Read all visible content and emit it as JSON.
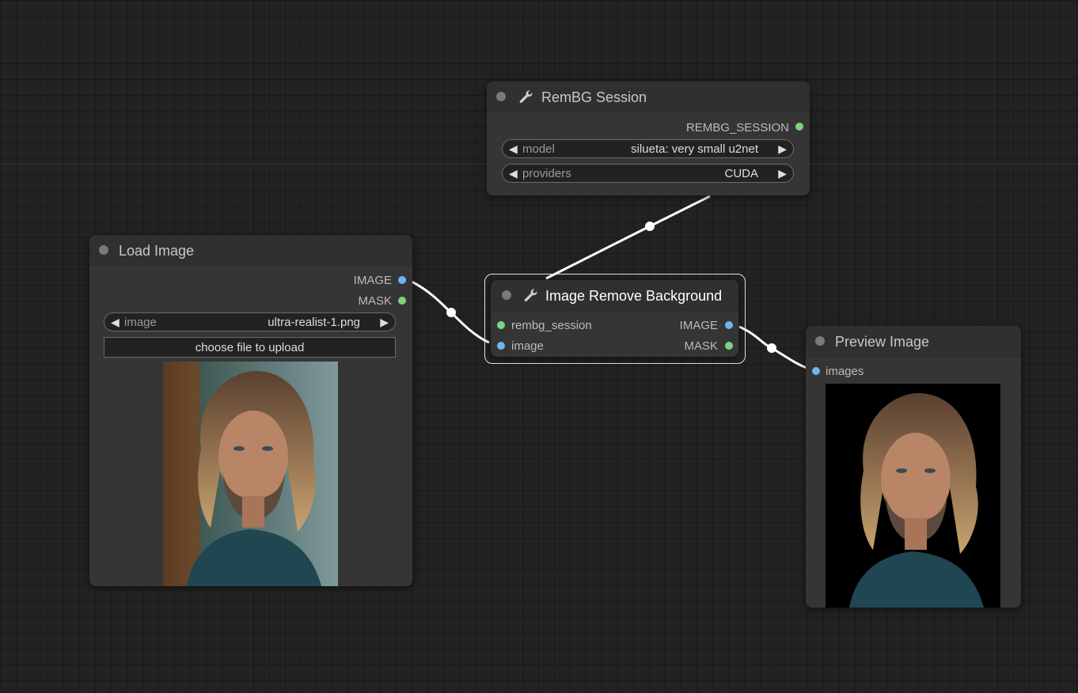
{
  "nodes": {
    "rembg_session": {
      "title": "RemBG Session",
      "outputs": [
        "REMBG_SESSION"
      ],
      "widgets": [
        {
          "name": "model",
          "value": "silueta: very small u2net"
        },
        {
          "name": "providers",
          "value": "CUDA"
        }
      ]
    },
    "load_image": {
      "title": "Load Image",
      "outputs": [
        "IMAGE",
        "MASK"
      ],
      "widgets": [
        {
          "name": "image",
          "value": "ultra-realist-1.png"
        }
      ],
      "upload_label": "choose file to upload"
    },
    "image_remove_background": {
      "title": "Image Remove Background",
      "inputs": [
        "rembg_session",
        "image"
      ],
      "outputs": [
        "IMAGE",
        "MASK"
      ]
    },
    "preview_image": {
      "title": "Preview Image",
      "inputs": [
        "images"
      ]
    }
  },
  "colors": {
    "canvas": "#222222",
    "node_body": "#353535",
    "image_port": "#6fb4ee",
    "mask_port": "#7fd27f",
    "link": "#ffffff"
  },
  "icons": {
    "node_collapse": "node-collapse-dot-icon",
    "node_type": "wrench-icon",
    "widget_decrement": "triangle-left-icon",
    "widget_increment": "triangle-right-icon"
  }
}
